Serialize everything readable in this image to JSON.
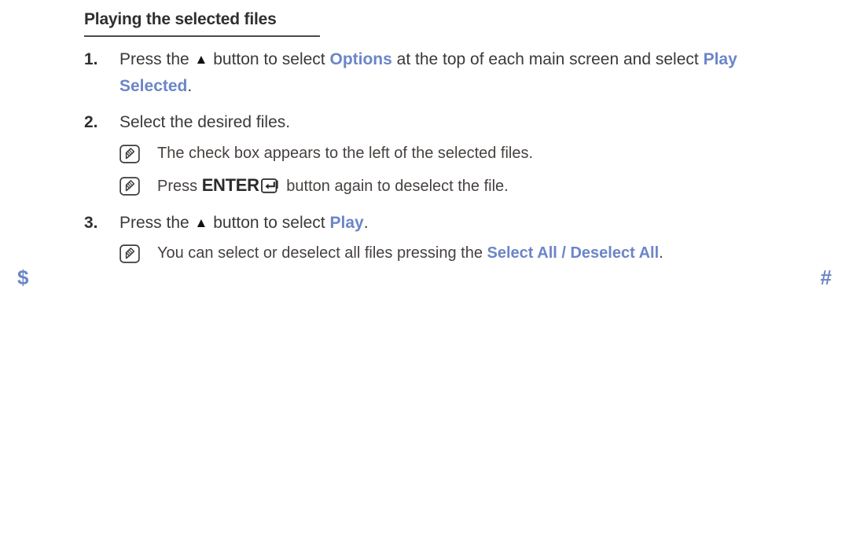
{
  "document": {
    "heading": "Playing the selected files",
    "accent_color": "#6b85c8",
    "text_color": "#3a3a3a"
  },
  "steps": [
    {
      "number": "1.",
      "parts": [
        {
          "text": "Press the ",
          "style": "plain"
        },
        {
          "text": "▲",
          "style": "triangle"
        },
        {
          "text": " button to select ",
          "style": "plain"
        },
        {
          "text": "Options",
          "style": "accent"
        },
        {
          "text": " at the top of each main screen and select ",
          "style": "plain"
        },
        {
          "text": "Play Selected",
          "style": "accent"
        },
        {
          "text": ".",
          "style": "plain"
        }
      ]
    },
    {
      "number": "2.",
      "parts": [
        {
          "text": "Select the desired files.",
          "style": "plain"
        }
      ]
    },
    {
      "number": "3.",
      "parts": [
        {
          "text": "Press the ",
          "style": "plain"
        },
        {
          "text": "▲",
          "style": "triangle"
        },
        {
          "text": " button to select ",
          "style": "plain"
        },
        {
          "text": "Play",
          "style": "accent"
        },
        {
          "text": ".",
          "style": "plain"
        }
      ]
    }
  ],
  "notes": [
    {
      "icon": "note-pencil-icon",
      "parts": [
        {
          "text": "The check box appears to the left of the selected files.",
          "style": "plain"
        }
      ]
    },
    {
      "icon": "note-pencil-icon",
      "parts": [
        {
          "text": "Press ",
          "style": "plain"
        },
        {
          "text": "ENTER",
          "style": "strong"
        },
        {
          "text": "",
          "style": "enter-key-icon"
        },
        {
          "text": " button again to deselect the file.",
          "style": "plain"
        }
      ]
    },
    {
      "icon": "note-pencil-icon",
      "parts": [
        {
          "text": "You can select or deselect all files pressing the ",
          "style": "plain"
        },
        {
          "text": "Select All / Deselect All",
          "style": "accent"
        },
        {
          "text": ".",
          "style": "plain"
        }
      ]
    }
  ],
  "markers": {
    "left": "$",
    "right": "#"
  }
}
